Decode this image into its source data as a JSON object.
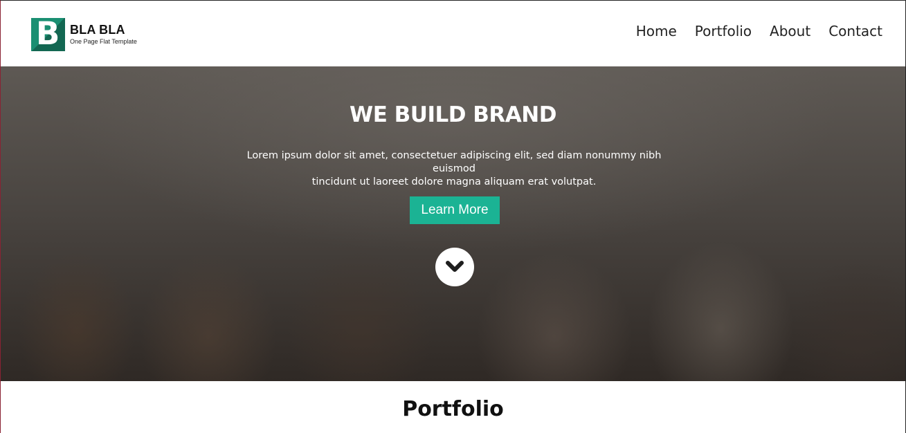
{
  "brand": {
    "logo_letter": "B",
    "name": "BLA BLA",
    "tagline": "One Page Flat Template",
    "accent_color": "#1a8f72"
  },
  "nav": {
    "items": [
      {
        "label": "Home"
      },
      {
        "label": "Portfolio"
      },
      {
        "label": "About"
      },
      {
        "label": "Contact"
      }
    ]
  },
  "hero": {
    "title_regular": "WE BUILD ",
    "title_bold": "BRAND",
    "text_line1": "Lorem ipsum dolor sit amet, consectetuer adipiscing elit, sed diam nonummy nibh euismod",
    "text_line2": "tincidunt ut laoreet dolore magna aliquam erat volutpat.",
    "button_label": "Learn More",
    "button_color": "#1bb394",
    "scroll_icon": "chevron-down-icon"
  },
  "portfolio": {
    "title": "Portfolio"
  }
}
